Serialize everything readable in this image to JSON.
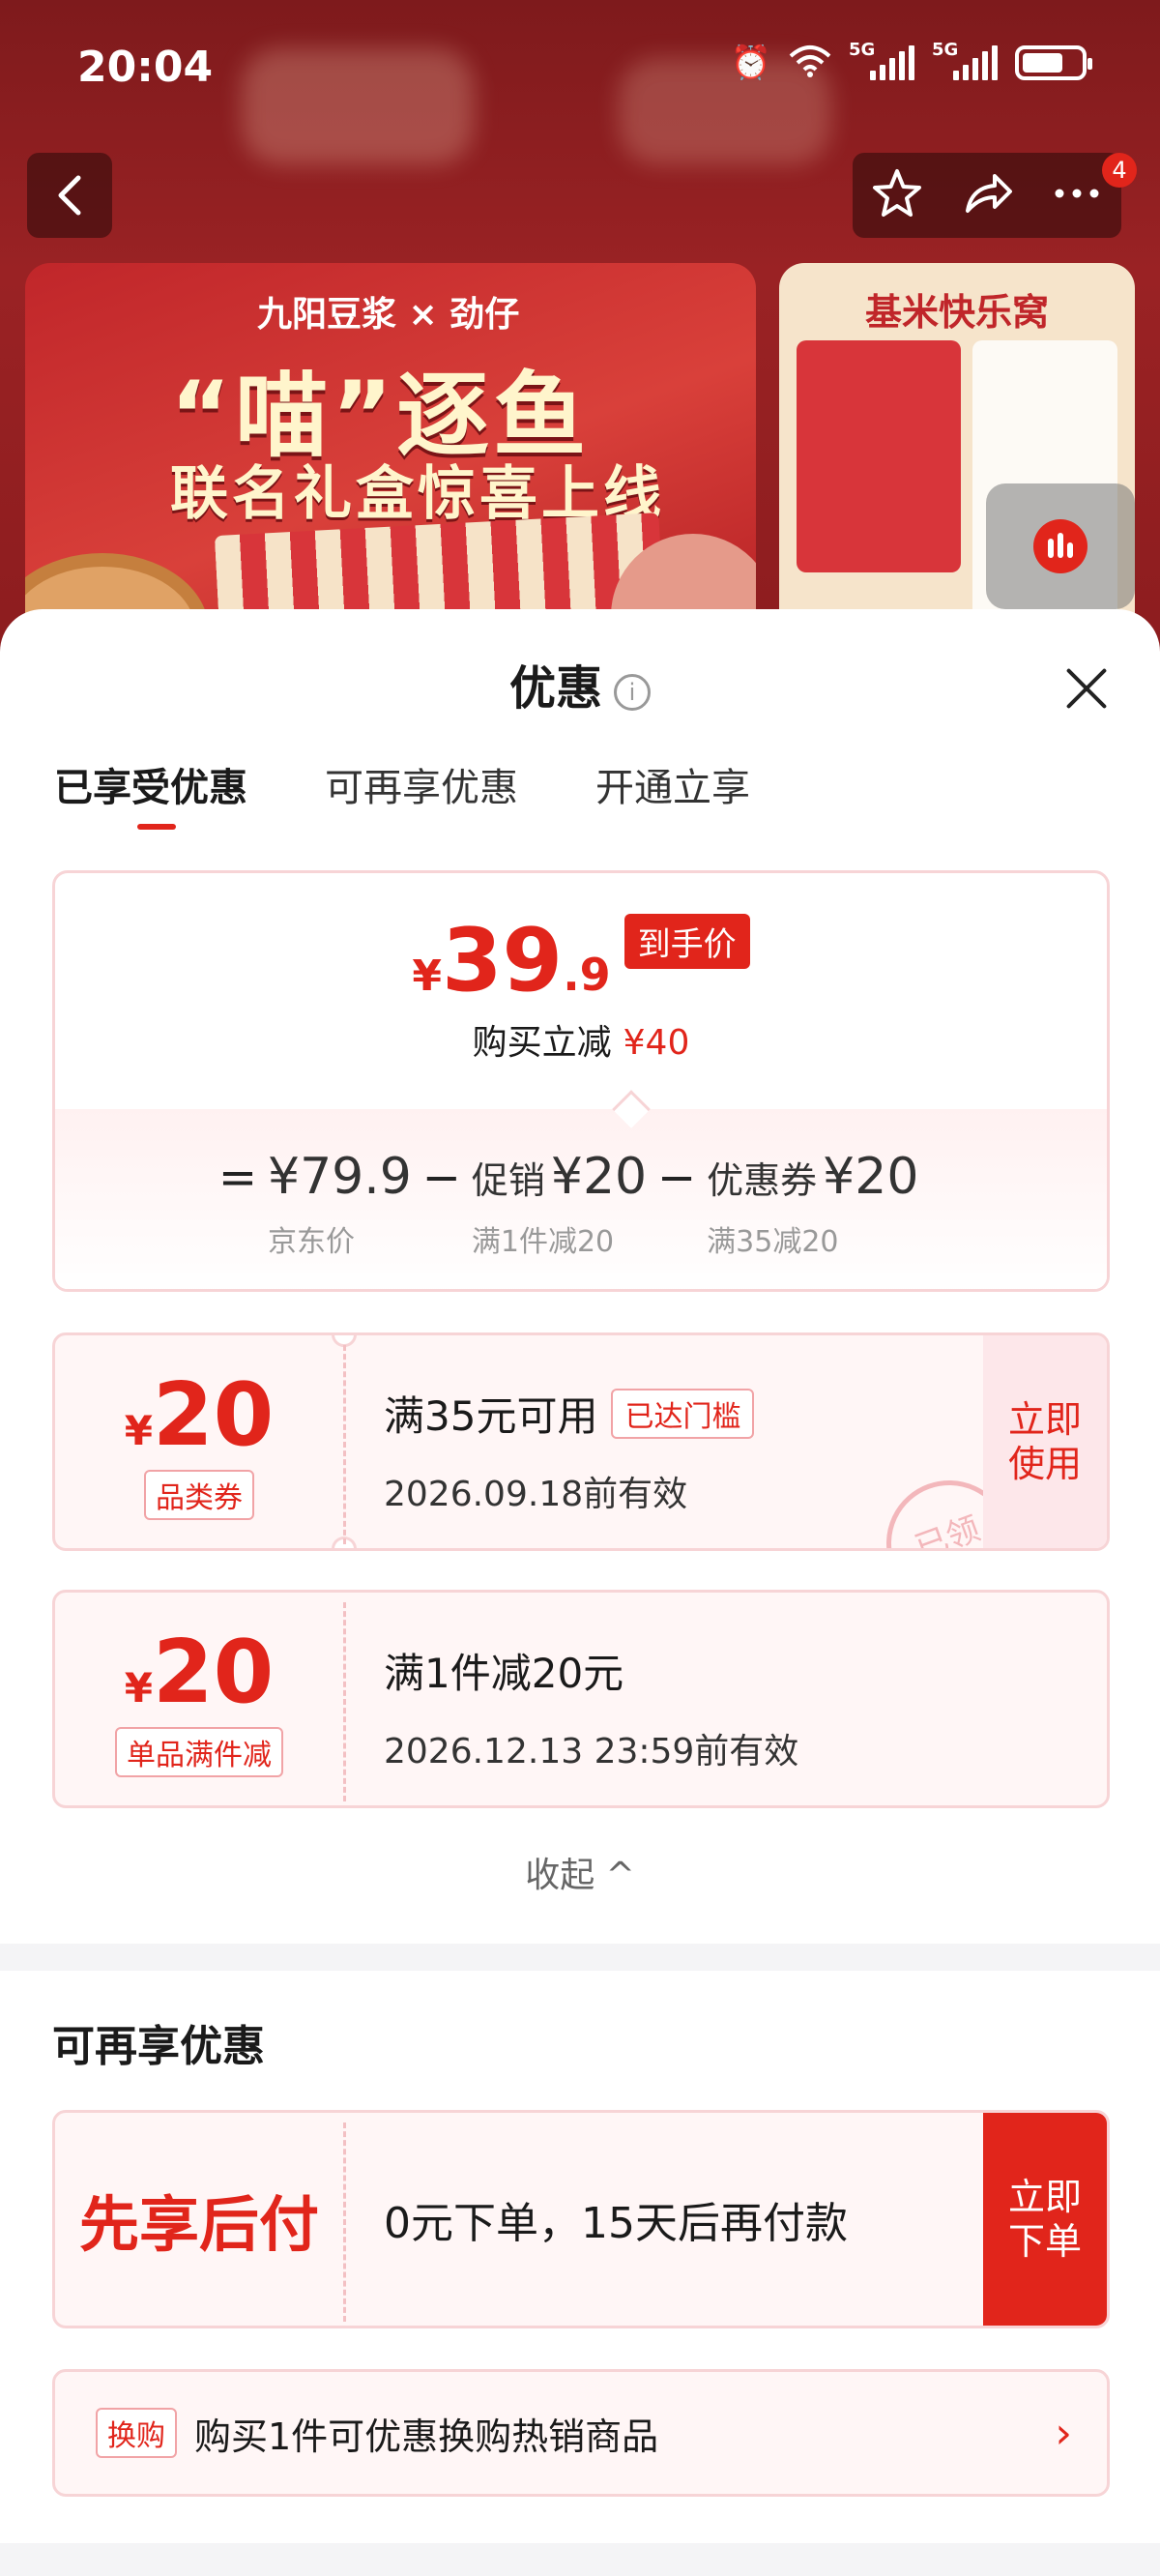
{
  "status_bar": {
    "time": "20:04",
    "net1": "5G",
    "net2": "5G"
  },
  "nav": {
    "badge_count": "4"
  },
  "banner_main": {
    "brand": "九阳豆浆 × 劲仔",
    "headline": "“喵”逐鱼",
    "subline": "联名礼盒惊喜上线"
  },
  "banner_side": {
    "title": "基米快乐窝"
  },
  "sheet": {
    "title": "优惠",
    "tabs": [
      {
        "label": "已享受优惠",
        "active": true
      },
      {
        "label": "可再享优惠",
        "active": false
      },
      {
        "label": "开通立享",
        "active": false
      }
    ],
    "price": {
      "yen": "¥",
      "int": "39",
      "dec": ".9",
      "tag": "到手价",
      "sub_label": "购买立减",
      "sub_value": "¥40",
      "formula": {
        "eq": "=",
        "base_value": "¥79.9",
        "base_caption": "京东价",
        "minus": "−",
        "promo_label": "促销",
        "promo_value": "¥20",
        "promo_caption": "满1件减20",
        "coupon_label": "优惠券",
        "coupon_value": "¥20",
        "coupon_caption": "满35减20"
      }
    },
    "coupons": [
      {
        "yen": "¥",
        "amount": "20",
        "kind": "品类券",
        "line1": "满35元可用",
        "met_tag": "已达门槛",
        "line2": "2026.09.18前有效",
        "use_label": "立即使用",
        "stamp": "已领"
      },
      {
        "yen": "¥",
        "amount": "20",
        "kind": "单品满件减",
        "line1": "满1件减20元",
        "line2": "2026.12.13 23:59前有效"
      }
    ],
    "collapse_label": "收起 ^",
    "more_section": {
      "title": "可再享优惠",
      "paylater": {
        "label": "先享后付",
        "desc": "0元下单，15天后再付款",
        "button": "立即下单"
      },
      "tradein": {
        "tag": "换购",
        "text": "购买1件可优惠换购热销商品",
        "chevron": "›"
      }
    }
  },
  "colors": {
    "accent": "#e1251b",
    "coupon_bg": "#fff6f6",
    "coupon_border": "#f7d4d6"
  }
}
